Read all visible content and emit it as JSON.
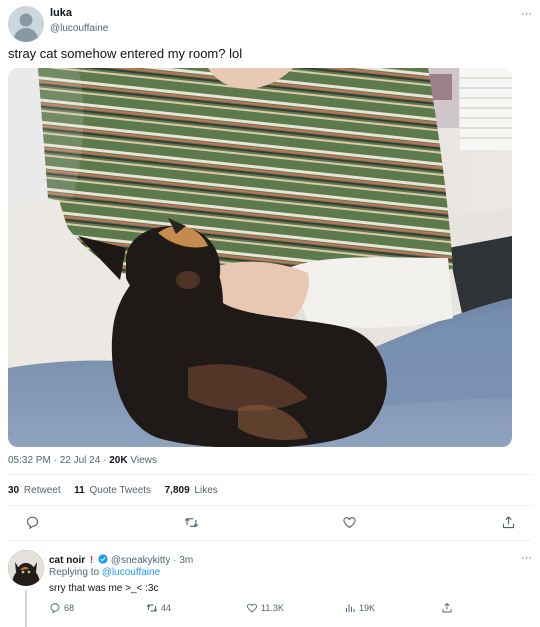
{
  "tweet": {
    "author_name": "luka",
    "author_handle": "@lucouffaine",
    "more": "···",
    "text": "stray cat somehow entered my room? lol",
    "time": "05:32 PM",
    "date": "22 Jul 24",
    "views_count": "20K",
    "views_label": "Views",
    "meta_sep": "·",
    "retweets_count": "30",
    "retweets_label": "Retweet",
    "quotes_count": "11",
    "quotes_label": "Quote Tweets",
    "likes_count": "7,809",
    "likes_label": "Likes",
    "actions": [
      "reply-icon",
      "retweet-icon",
      "like-icon",
      "share-icon"
    ]
  },
  "reply": {
    "author_name": "cat noir",
    "author_emoji": "!",
    "author_handle": "@sneakykitty",
    "sep": "·",
    "time": "3m",
    "replying_prefix": "Replying to",
    "replying_to": "@lucouffaine",
    "text": "srry that was me >_< :3c",
    "more": "···",
    "replies": "68",
    "retweets": "44",
    "likes": "11.3K",
    "views": "19K"
  },
  "colors": {
    "accent": "#1d9bf0",
    "text": "#0f1419",
    "muted": "#536471",
    "divider": "#eff3f4",
    "alert": "#e0245e"
  }
}
